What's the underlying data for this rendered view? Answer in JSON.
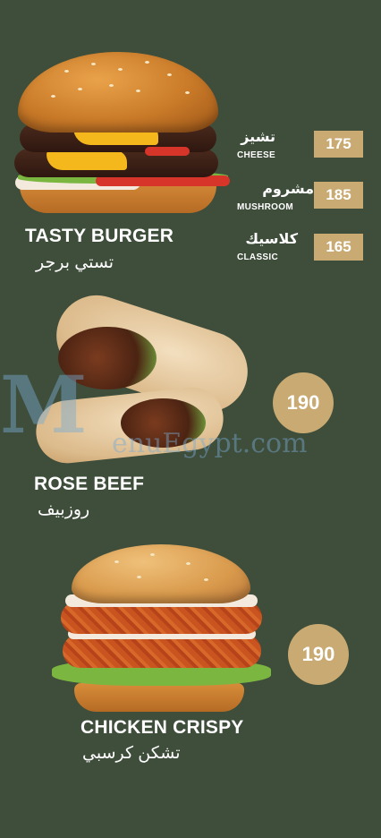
{
  "items": [
    {
      "name_en": "TASTY BURGER",
      "name_ar": "تستي برجر",
      "options": [
        {
          "name_ar": "تشيز",
          "name_en": "CHEESE",
          "price": "175"
        },
        {
          "name_ar": "مشروم",
          "name_en": "MUSHROOM",
          "price": "185"
        },
        {
          "name_ar": "كلاسيك",
          "name_en": "CLASSIC",
          "price": "165"
        }
      ]
    },
    {
      "name_en": "ROSE BEEF",
      "name_ar": "روزبيف",
      "price": "190"
    },
    {
      "name_en": "CHICKEN CRISPY",
      "name_ar": "تشكن كرسبي",
      "price": "190"
    }
  ],
  "watermark": {
    "logo": "M",
    "text": "enuEgypt.com"
  },
  "colors": {
    "background": "#3f4d3b",
    "price_badge": "#c9aa72"
  }
}
